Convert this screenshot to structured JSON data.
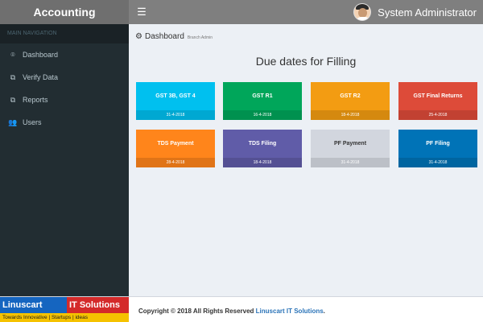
{
  "header": {
    "brand": "Accounting",
    "toggle_icon": "☰",
    "user_name": "System Administrator"
  },
  "sidebar": {
    "header": "MAIN NAVIGATION",
    "items": [
      {
        "label": "Dashboard",
        "icon": "⌾"
      },
      {
        "label": "Verify Data",
        "icon": "⧉"
      },
      {
        "label": "Reports",
        "icon": "⧉"
      },
      {
        "label": "Users",
        "icon": "👥"
      }
    ]
  },
  "content": {
    "breadcrumb": {
      "icon": "⚙",
      "title": "Dashboard",
      "subtitle": "Branch Admin"
    },
    "section_title": "Due dates for Filling",
    "cards": [
      {
        "title": "GST 3B, GST 4",
        "date": "31-4-2018",
        "color": "#00c0ef"
      },
      {
        "title": "GST R1",
        "date": "16-4-2018",
        "color": "#00a65a"
      },
      {
        "title": "GST R2",
        "date": "18-4-2018",
        "color": "#f39c12"
      },
      {
        "title": "GST Final Returns",
        "date": "25-4-2018",
        "color": "#dd4b39"
      },
      {
        "title": "TDS Payment",
        "date": "28-4-2018",
        "color": "#ff851b"
      },
      {
        "title": "TDS Filing",
        "date": "18-4-2018",
        "color": "#605ca8"
      },
      {
        "title": "PF Payment",
        "date": "31-4-2018",
        "color": "#d2d6de"
      },
      {
        "title": "PF Filing",
        "date": "31-4-2018",
        "color": "#0073b7"
      }
    ]
  },
  "footer": {
    "logo_part1": "Linuscart",
    "logo_part2": "IT Solutions",
    "logo_tagline": "Towards Innovative | Startups | ideas",
    "copyright_prefix": "Copyright © 2018 All Rights Reserved",
    "company_link": "Linuscart IT Solutions",
    "copyright_suffix": "."
  }
}
